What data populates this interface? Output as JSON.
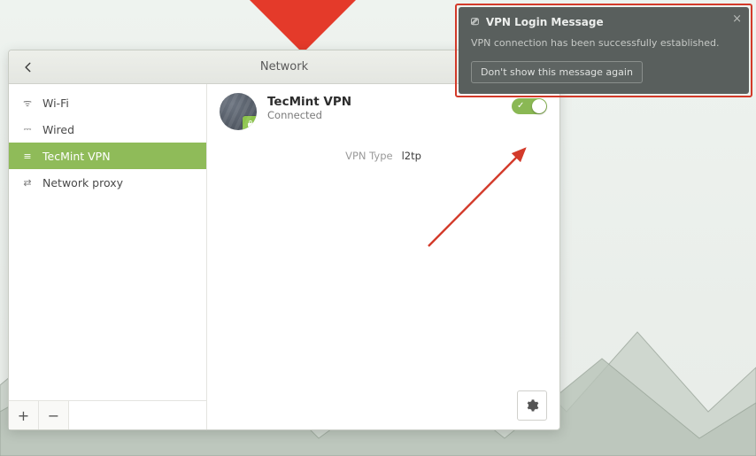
{
  "window": {
    "title": "Network"
  },
  "sidebar": {
    "items": [
      {
        "id": "wifi",
        "label": "Wi-Fi",
        "icon": "wifi-icon",
        "active": false
      },
      {
        "id": "wired",
        "label": "Wired",
        "icon": "wired-icon",
        "active": false
      },
      {
        "id": "vpn",
        "label": "TecMint VPN",
        "icon": "vpn-icon",
        "active": true
      },
      {
        "id": "proxy",
        "label": "Network proxy",
        "icon": "proxy-icon",
        "active": false
      }
    ],
    "glyphs": {
      "wifi": "ᯤ",
      "wired": "⎓",
      "vpn": "≡",
      "proxy": "⇄"
    }
  },
  "connection": {
    "name": "TecMint VPN",
    "state": "Connected",
    "enabled": true,
    "properties": {
      "vpn_type_label": "VPN Type",
      "vpn_type_value": "l2tp"
    }
  },
  "notification": {
    "title": "VPN Login Message",
    "body": "VPN connection has been successfully established.",
    "button": "Don't show this message again"
  },
  "colors": {
    "accent": "#8fbb59",
    "danger": "#d33a2a"
  }
}
